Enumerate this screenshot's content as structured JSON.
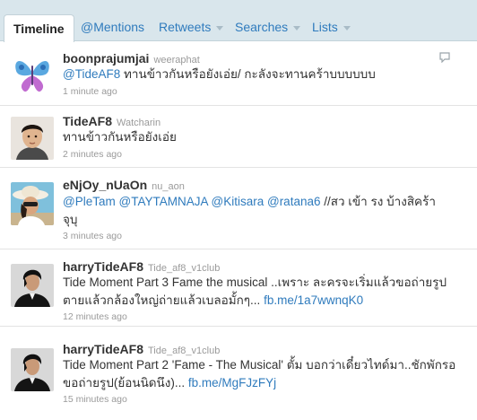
{
  "tabs": [
    {
      "label": "Timeline",
      "active": true
    },
    {
      "label": "@Mentions"
    },
    {
      "label": "Retweets",
      "dropdown": true
    },
    {
      "label": "Searches",
      "dropdown": true
    },
    {
      "label": "Lists",
      "dropdown": true
    }
  ],
  "tweets": [
    {
      "username": "boonprajumjai",
      "realname": "weeraphat",
      "segments": [
        {
          "text": "@TideAF8",
          "link": true
        },
        {
          "text": " ทานข้าวกันหรือยังเอ่ย/ กะลังจะทานคร้าบบบบบบ",
          "link": false
        }
      ],
      "time": "1 minute ago",
      "avatar": "butterfly"
    },
    {
      "username": "TideAF8",
      "realname": "Watcharin",
      "segments": [
        {
          "text": "ทานข้าวกันหรือยังเอ่ย",
          "link": false
        }
      ],
      "time": "2 minutes ago",
      "avatar": "portrait"
    },
    {
      "username": "eNjOy_nUaOn",
      "realname": "nu_aon",
      "segments": [
        {
          "text": "@PleTam",
          "link": true
        },
        {
          "text": " ",
          "link": false
        },
        {
          "text": "@TAYTAMNAJA",
          "link": true
        },
        {
          "text": " ",
          "link": false
        },
        {
          "text": "@Kitisara",
          "link": true
        },
        {
          "text": " ",
          "link": false
        },
        {
          "text": "@ratana6",
          "link": true
        },
        {
          "text": " //สว เข้า รง บ้างสิคร้า จุบุ",
          "link": false
        }
      ],
      "time": "3 minutes ago",
      "avatar": "woman-hat"
    },
    {
      "username": "harryTideAF8",
      "realname": "Tide_af8_v1club",
      "segments": [
        {
          "text": "Tide Moment Part 3 Fame the musical ..เพราะ ละครจะเริ่มแล้วขอถ่ายรูปตายแล้วกล้องใหญ่ถ่ายแล้วเบลอมั้กๆ... ",
          "link": false
        },
        {
          "text": "fb.me/1a7wwnqK0",
          "link": true
        }
      ],
      "time": "12 minutes ago",
      "avatar": "man-suit"
    },
    {
      "username": "harryTideAF8",
      "realname": "Tide_af8_v1club",
      "segments": [
        {
          "text": "Tide Moment Part 2 'Fame - The Musical' ตั้ม บอกว่าเดี๋ยวไทด์มา..ชักพักรอขอถ่ายรูป(ย้อนนิดนึง)... ",
          "link": false
        },
        {
          "text": "fb.me/MgFJzFYj",
          "link": true
        }
      ],
      "time": "15 minutes ago",
      "avatar": "man-suit"
    }
  ]
}
